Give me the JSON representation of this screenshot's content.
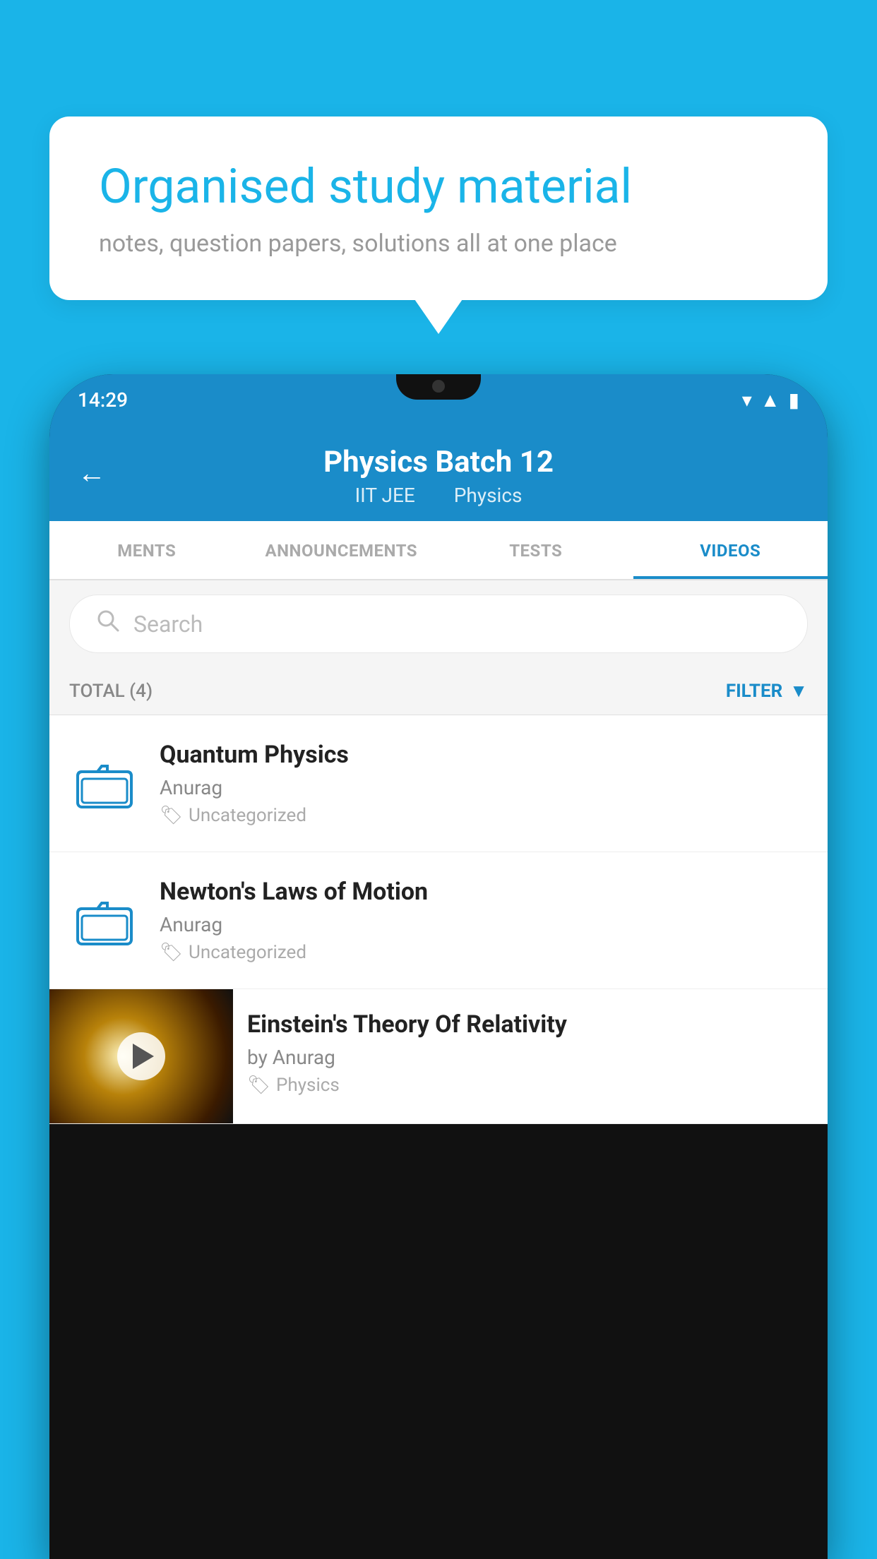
{
  "background_color": "#1ab4e8",
  "bubble": {
    "title": "Organised study material",
    "subtitle": "notes, question papers, solutions all at one place"
  },
  "phone": {
    "status_bar": {
      "time": "14:29",
      "icons": [
        "wifi",
        "signal",
        "battery"
      ]
    },
    "header": {
      "back_label": "←",
      "title": "Physics Batch 12",
      "subtitle_part1": "IIT JEE",
      "subtitle_part2": "Physics"
    },
    "tabs": [
      {
        "label": "MENTS",
        "active": false
      },
      {
        "label": "ANNOUNCEMENTS",
        "active": false
      },
      {
        "label": "TESTS",
        "active": false
      },
      {
        "label": "VIDEOS",
        "active": true
      }
    ],
    "search": {
      "placeholder": "Search"
    },
    "filter": {
      "total_label": "TOTAL (4)",
      "filter_label": "FILTER"
    },
    "videos": [
      {
        "title": "Quantum Physics",
        "author": "Anurag",
        "tag": "Uncategorized",
        "has_thumbnail": false
      },
      {
        "title": "Newton's Laws of Motion",
        "author": "Anurag",
        "tag": "Uncategorized",
        "has_thumbnail": false
      },
      {
        "title": "Einstein's Theory Of Relativity",
        "author": "by Anurag",
        "tag": "Physics",
        "has_thumbnail": true
      }
    ]
  }
}
